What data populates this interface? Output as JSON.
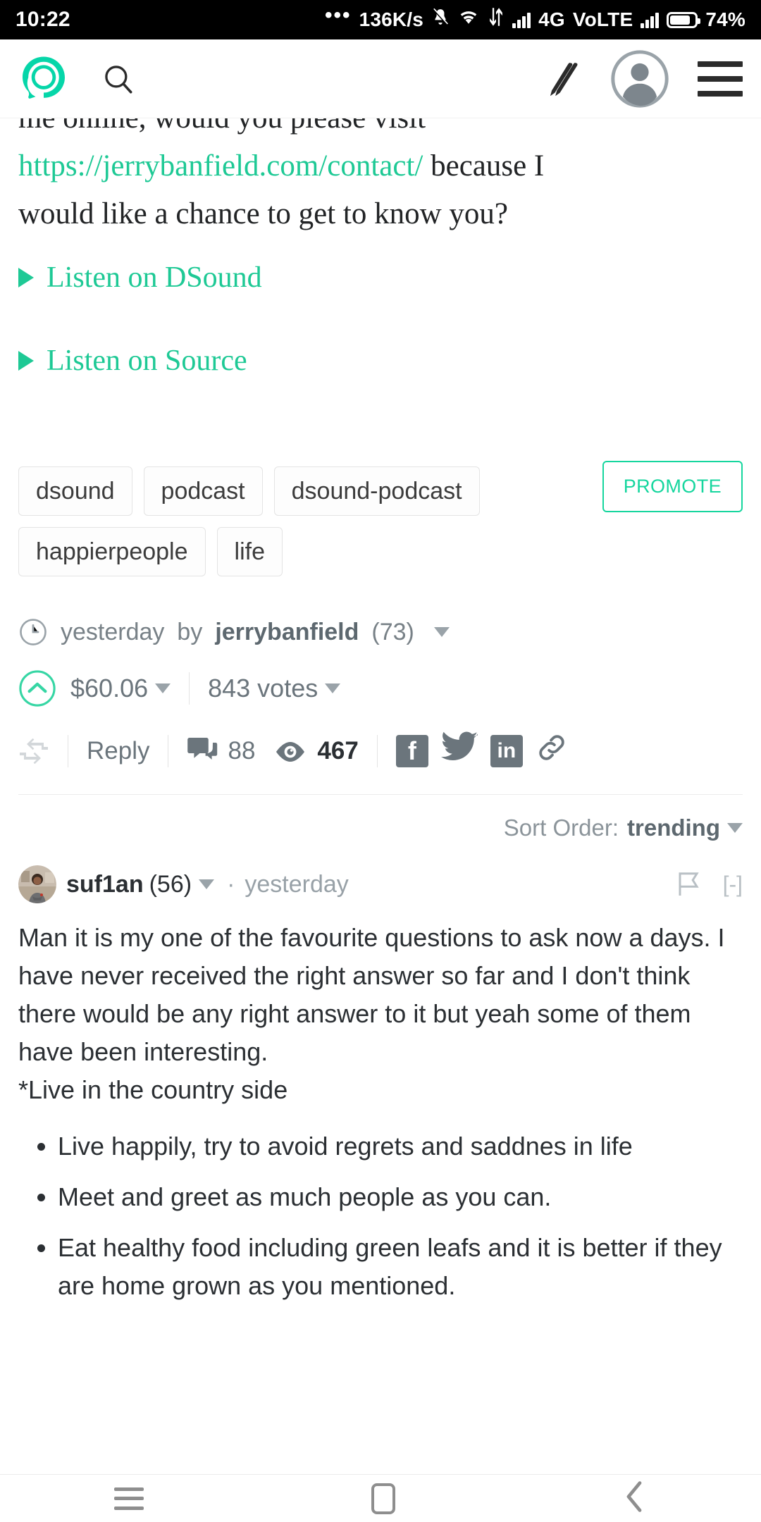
{
  "statusbar": {
    "time": "10:22",
    "overflow_dots": "•••",
    "net_speed": "136K/s",
    "network_type": "4G",
    "volte": "VoLTE",
    "battery": "74%",
    "icons": [
      "mute-icon",
      "wifi-icon",
      "data-transfer-icon",
      "signal-bars-icon",
      "signal-bars-icon",
      "battery-icon"
    ]
  },
  "appbar": {
    "logo_name": "steemit-logo",
    "logo_color": "#06D6A9",
    "search_label": "search-icon",
    "pen_label": "pen-icon",
    "avatar_label": "account-avatar",
    "menu_label": "hamburger-menu-icon"
  },
  "post": {
    "clipped_line": "me online, would you please visit",
    "link_text": "https://jerrybanfield.com/contact/",
    "after_link": " because I",
    "line3": "would like a chance to get to know you?",
    "listen_links": [
      "Listen on DSound",
      "Listen on Source"
    ],
    "link_color": "#1ec995"
  },
  "tags": {
    "items": [
      "dsound",
      "podcast",
      "dsound-podcast",
      "happierpeople",
      "life"
    ],
    "promote_label": "PROMOTE",
    "promote_color": "#16d69e"
  },
  "meta": {
    "time_ago": "yesterday",
    "by_word": "by",
    "author": "jerrybanfield",
    "author_rep": "(73)",
    "payout": "$60.06",
    "votes": "843 votes",
    "reply_label": "Reply",
    "comment_count": "88",
    "view_count": "467",
    "share_icons": [
      "facebook-icon",
      "twitter-icon",
      "linkedin-icon",
      "link-icon"
    ],
    "facebook_glyph": "f",
    "linkedin_glyph": "in"
  },
  "sort": {
    "label": "Sort Order:",
    "value": "trending"
  },
  "comment": {
    "author": "suf1an",
    "rep": "(56)",
    "separator": "·",
    "time_ago": "yesterday",
    "collapse_label": "[-]",
    "flag_label": "flag-icon",
    "paragraph1": "Man it is my one of the favourite questions to ask now a days. I have never received the right answer so far and I don't think there would be any right answer to it but yeah some of them have been interesting.",
    "paragraph2": "*Live in the country side",
    "bullets": [
      "Live happily, try to avoid regrets and saddnes in life",
      "Meet and greet as much people as you can.",
      "Eat healthy food including green leafs and it is better if they are home grown as you mentioned."
    ]
  },
  "navbar": {
    "recents": "recents-icon",
    "home": "home-icon",
    "back": "back-icon",
    "back_glyph": "‹"
  }
}
